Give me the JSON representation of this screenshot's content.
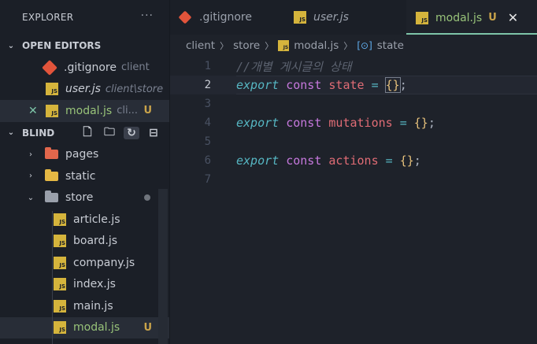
{
  "sidebar": {
    "title": "EXPLORER",
    "more": "···",
    "open_editors": {
      "label": "OPEN EDITORS",
      "items": [
        {
          "name": ".gitignore",
          "detail": "client"
        },
        {
          "name": "user.js",
          "detail": "client\\store"
        },
        {
          "name": "modal.js",
          "detail": "cli...",
          "status": "U",
          "close": "✕"
        }
      ]
    },
    "workspace": {
      "label": "BLIND",
      "folders": [
        {
          "name": "pages"
        },
        {
          "name": "static"
        },
        {
          "name": "store"
        }
      ],
      "files": [
        {
          "name": "article.js"
        },
        {
          "name": "board.js"
        },
        {
          "name": "company.js"
        },
        {
          "name": "index.js"
        },
        {
          "name": "main.js"
        },
        {
          "name": "modal.js",
          "status": "U"
        }
      ]
    }
  },
  "tabs": [
    {
      "label": ".gitignore"
    },
    {
      "label": "user.js"
    },
    {
      "label": "modal.js",
      "status": "U",
      "close": "✕"
    }
  ],
  "breadcrumb": {
    "parts": [
      "client",
      "store",
      "modal.js",
      "state"
    ]
  },
  "editor": {
    "current_line": 2,
    "line_numbers": [
      "1",
      "2",
      "3",
      "4",
      "5",
      "6",
      "7"
    ],
    "comment": "//개별 게시글의 상태",
    "lines": {
      "l2": {
        "kw1": "export",
        "kw2": "const",
        "name": "state",
        "op": "=",
        "value": "{}",
        "end": ";"
      },
      "l4": {
        "kw1": "export",
        "kw2": "const",
        "name": "mutations",
        "op": "=",
        "value": "{}",
        "end": ";"
      },
      "l6": {
        "kw1": "export",
        "kw2": "const",
        "name": "actions",
        "op": "=",
        "value": "{}",
        "end": ";"
      }
    }
  },
  "icons": {
    "js": "JS",
    "chevron_down": "⌄",
    "chevron_right": "›",
    "new_file": "🗋",
    "new_folder": "🗀",
    "refresh": "↻",
    "collapse": "⊟"
  },
  "colors": {
    "accent": "#7dc4a8",
    "untracked": "#c9a34a",
    "js_icon": "#d5b43c",
    "git_icon": "#e2543b"
  }
}
